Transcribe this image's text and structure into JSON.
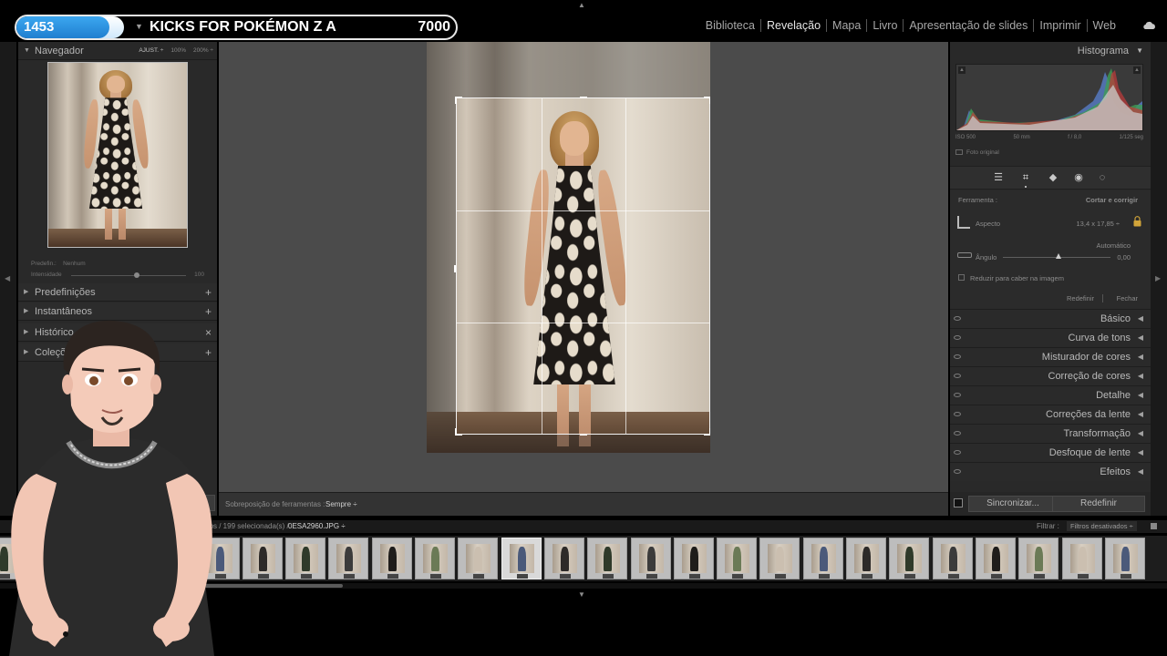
{
  "stream_banner": {
    "count": "1453",
    "title": "KICKS FOR POKÉMON Z A",
    "goal": "7000"
  },
  "modules": [
    "Biblioteca",
    "Revelação",
    "Mapa",
    "Livro",
    "Apresentação de slides",
    "Imprimir",
    "Web"
  ],
  "active_module": "Revelação",
  "navigator": {
    "title": "Navegador",
    "zoom_options": [
      "AJUST. ÷",
      "100%",
      "200% ÷"
    ],
    "preset_label": "Predefin.:",
    "preset_value": "Nenhum",
    "intensity_label": "Intensidade",
    "intensity_value": "100",
    "intensity_fraction": 0.57
  },
  "left_panels": [
    {
      "label": "Predefinições",
      "action": "+"
    },
    {
      "label": "Instantâneos",
      "action": "+"
    },
    {
      "label": "Histórico",
      "action": "×"
    },
    {
      "label": "Coleções",
      "action": "+"
    }
  ],
  "toolbar": {
    "overlay_label": "Sobreposição de ferramentas :",
    "overlay_value": "Sempre ÷"
  },
  "histogram": {
    "title": "Histograma",
    "iso": "ISO 500",
    "focal": "50 mm",
    "aperture": "f / 8,0",
    "shutter": "1/125 seg",
    "original_photo": "Foto original"
  },
  "crop": {
    "tool_label": "Ferramenta :",
    "tool_name": "Cortar e corrigir",
    "aspect_label": "Aspecto",
    "aspect_value": "13,4 x 17,85 ÷",
    "auto_label": "Automático",
    "angle_label": "Ângulo",
    "angle_value": "0,00",
    "constrain_label": "Reduzir para caber na imagem",
    "reset_label": "Redefinir",
    "close_label": "Fechar"
  },
  "edit_panels": [
    "Básico",
    "Curva de tons",
    "Misturador de cores",
    "Correção de cores",
    "Detalhe",
    "Correções da lente",
    "Transformação",
    "Desfoque de lente",
    "Efeitos"
  ],
  "sync": {
    "sync_label": "Sincronizar...",
    "reset_label": "Redefinir"
  },
  "filmstrip": {
    "count_text": "9 fotos / 199 selecionada(s) /",
    "file_name": "0ESA2960.JPG ÷",
    "filter_label": "Filtrar :",
    "filter_value": "Filtros desativados ÷",
    "selected_index": 8
  },
  "colors": {
    "counter_blue": "#1f7fd0",
    "panel_bg": "#292929",
    "canvas_bg": "#4b4b4b"
  }
}
